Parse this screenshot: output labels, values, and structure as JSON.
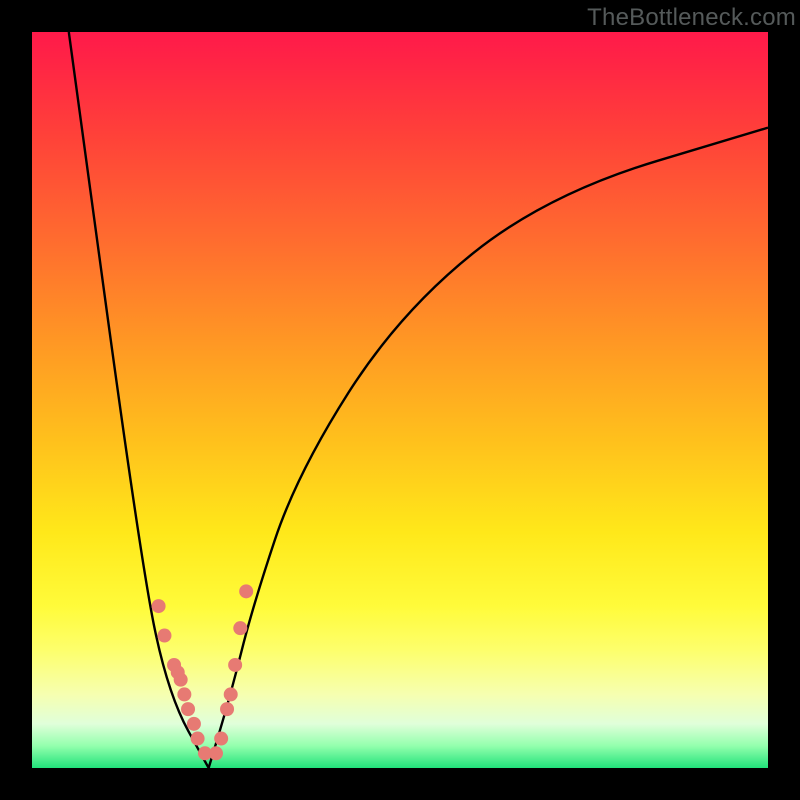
{
  "watermark": "TheBottleneck.com",
  "chart_data": {
    "type": "scatter",
    "title": "",
    "xlabel": "",
    "ylabel": "",
    "xlim": [
      0,
      100
    ],
    "ylim": [
      0,
      100
    ],
    "background_gradient": {
      "top_color": "#ff1a4a",
      "mid_color": "#ffe81a",
      "bottom_color": "#21e27a",
      "meaning": "red(high bottleneck) to green(no bottleneck)"
    },
    "series": [
      {
        "name": "bottleneck-curve-left",
        "type": "line",
        "x": [
          5,
          14.8,
          18.5,
          24.0
        ],
        "y": [
          100,
          28,
          10,
          0
        ],
        "stroke": "#000000"
      },
      {
        "name": "bottleneck-curve-right",
        "type": "line",
        "x": [
          24.0,
          27.0,
          30.0,
          36.0,
          50.0,
          70.0,
          100.0
        ],
        "y": [
          0,
          10,
          22,
          40,
          62,
          78,
          87
        ],
        "stroke": "#000000"
      },
      {
        "name": "data-points",
        "type": "scatter",
        "x": [
          17.2,
          18.0,
          19.3,
          19.8,
          20.2,
          20.7,
          21.2,
          22.0,
          22.5,
          23.5,
          25.0,
          25.7,
          26.5,
          27.0,
          27.6,
          28.3,
          29.1
        ],
        "y": [
          22,
          18,
          14,
          13,
          12,
          10,
          8,
          6,
          4,
          2,
          2,
          4,
          8,
          10,
          14,
          19,
          24
        ],
        "marker_color": "#e77a73",
        "marker_radius_px": 7
      }
    ]
  }
}
